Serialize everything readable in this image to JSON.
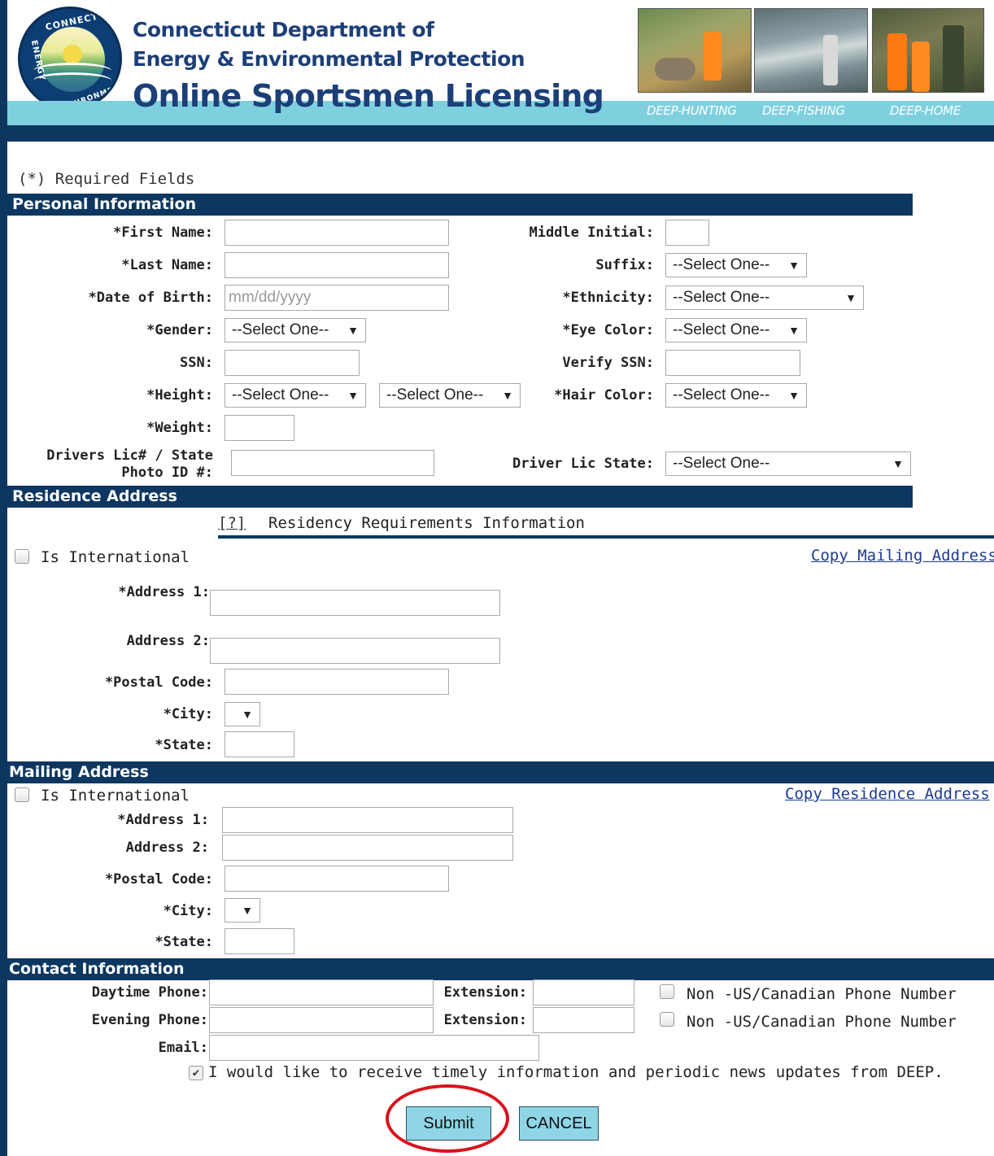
{
  "header": {
    "logo_text_top": "CONNECTICUT",
    "logo_text_left": "ENERGY",
    "logo_text_right": "ENVIRONMENT",
    "line1": "Connecticut Department of",
    "line2": "Energy & Environmental Protection",
    "line3": "Online Sportsmen Licensing",
    "nav": [
      "DEEP-HUNTING",
      "DEEP-FISHING",
      "DEEP-HOME"
    ]
  },
  "form": {
    "required_note": "(*) Required Fields",
    "select_placeholder": "--Select One--",
    "personal": {
      "title": "Personal Information",
      "first_name": "*First Name:",
      "middle_initial": "Middle Initial:",
      "last_name": "*Last Name:",
      "suffix": "Suffix:",
      "dob": "*Date of Birth:",
      "dob_placeholder": "mm/dd/yyyy",
      "ethnicity": "*Ethnicity:",
      "gender": "*Gender:",
      "eye_color": "*Eye Color:",
      "ssn": "SSN:",
      "verify_ssn": "Verify SSN:",
      "height": "*Height:",
      "hair_color": "*Hair Color:",
      "weight": "*Weight:",
      "drivers_lic_1": "Drivers Lic# / State",
      "drivers_lic_2": "Photo ID #:",
      "driver_lic_state": "Driver Lic State:"
    },
    "residence": {
      "title": "Residence Address",
      "help_tag": "[?]",
      "help_text": "Residency Requirements Information",
      "is_international": "Is International",
      "copy_link": "Copy Mailing Address",
      "address1": "*Address 1:",
      "address2": "Address 2:",
      "postal": "*Postal Code:",
      "city": "*City:",
      "state": "*State:"
    },
    "mailing": {
      "title": "Mailing Address",
      "is_international": "Is International",
      "copy_link": "Copy Residence Address",
      "address1": "*Address 1:",
      "address2": "Address 2:",
      "postal": "*Postal Code:",
      "city": "*City:",
      "state": "*State:"
    },
    "contact": {
      "title": "Contact Information",
      "daytime": "Daytime Phone:",
      "evening": "Evening Phone:",
      "extension": "Extension:",
      "non_us": "Non -US/Canadian Phone Number",
      "email": "Email:",
      "newsletter": "I would like to receive timely information and periodic news updates from DEEP."
    },
    "buttons": {
      "submit": "Submit",
      "cancel": "CANCEL"
    }
  },
  "colors": {
    "navy": "#0d3760",
    "teal": "#7fd0df",
    "button": "#8fd5e6",
    "highlight_circle": "#d9121b"
  }
}
